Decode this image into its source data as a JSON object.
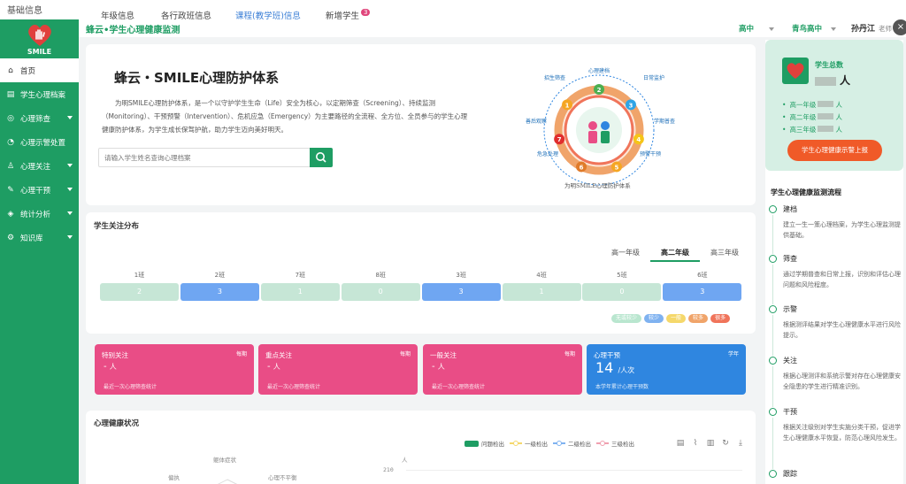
{
  "top": {
    "base_info": "基础信息",
    "tabs": [
      {
        "label": "年级信息"
      },
      {
        "label": "各行政班信息"
      },
      {
        "label": "课程(教学班)信息"
      },
      {
        "label": "新增学生",
        "badge": "3"
      }
    ]
  },
  "sidebar": {
    "logo_text": "SMILE",
    "items": [
      {
        "label": "首页",
        "icon": "home-icon"
      },
      {
        "label": "学生心理档案",
        "icon": "archive-icon"
      },
      {
        "label": "心理筛查",
        "icon": "location-icon"
      },
      {
        "label": "心理示警处置",
        "icon": "bell-icon"
      },
      {
        "label": "心理关注",
        "icon": "user-icon"
      },
      {
        "label": "心理干预",
        "icon": "tool-icon"
      },
      {
        "label": "统计分析",
        "icon": "shield-icon"
      },
      {
        "label": "知识库",
        "icon": "settings-icon"
      }
    ]
  },
  "header": {
    "title": "蜂云•学生心理健康监测",
    "school_stage": "高中",
    "school_name": "青鸟高中",
    "user_name": "孙丹江",
    "user_role": "老师"
  },
  "intro": {
    "heading": "蜂云・SMILE心理防护体系",
    "paragraph": "为明SMILE心理防护体系，是一个以守护学生生命（Life）安全为核心，以定期筛查（Screening）、持续监测（Monitoring）、干预预警（Intervention）、危机应急（Emergency）为主要路径的全流程、全方位、全员参与的学生心理健康防护体系，为学生成长保驾护航，助力学生迈向美好明天。",
    "search_placeholder": "请输入学生姓名查询心理档案",
    "diagram_caption": "为明SMILE心理防护体系",
    "diagram_labels": [
      {
        "num": "1",
        "label": "招生筛查",
        "color": "#f5a623"
      },
      {
        "num": "2",
        "label": "心理建档",
        "color": "#4caf50"
      },
      {
        "num": "3",
        "label": "日常监护",
        "color": "#2fa4e7"
      },
      {
        "num": "4",
        "label": "学期普查",
        "color": "#f5c518"
      },
      {
        "num": "5",
        "label": "预警干预",
        "color": "#f5a623"
      },
      {
        "num": "6",
        "label": "危急处理",
        "color": "#e07b2a"
      },
      {
        "num": "7",
        "label": "善后观察",
        "color": "#e02e2e"
      }
    ]
  },
  "distribution": {
    "title": "学生关注分布",
    "grade_tabs": [
      "高一年级",
      "高二年级",
      "高三年级"
    ],
    "active_grade": 1,
    "classes": [
      {
        "name": "1班",
        "value": "2",
        "level": "normal"
      },
      {
        "name": "2班",
        "value": "3",
        "level": "blue"
      },
      {
        "name": "7班",
        "value": "1",
        "level": "normal"
      },
      {
        "name": "8班",
        "value": "0",
        "level": "normal"
      },
      {
        "name": "3班",
        "value": "3",
        "level": "blue"
      },
      {
        "name": "4班",
        "value": "1",
        "level": "normal"
      },
      {
        "name": "5班",
        "value": "0",
        "level": "normal"
      },
      {
        "name": "6班",
        "value": "3",
        "level": "blue"
      }
    ],
    "legend": [
      {
        "label": "无或较少",
        "color": "#b9e6cf"
      },
      {
        "label": "较少",
        "color": "#7fb2f0"
      },
      {
        "label": "一般",
        "color": "#f5d86b"
      },
      {
        "label": "较多",
        "color": "#f0a46a"
      },
      {
        "label": "很多",
        "color": "#f0745a"
      }
    ]
  },
  "stats": [
    {
      "title": "特别关注",
      "right": "每期",
      "value": "-",
      "unit": "人",
      "note": "最近一次心理筛查统计",
      "color": "#e94d86"
    },
    {
      "title": "重点关注",
      "right": "每期",
      "value": "-",
      "unit": "人",
      "note": "最近一次心理筛查统计",
      "color": "#e94d86"
    },
    {
      "title": "一般关注",
      "right": "每期",
      "value": "-",
      "unit": "人",
      "note": "最近一次心理筛查统计",
      "color": "#e94d86"
    },
    {
      "title": "心理干预",
      "right": "学年",
      "value": "14",
      "unit": "/人次",
      "note": "本学年累计心理干预数",
      "color": "#2f86e0"
    }
  ],
  "health": {
    "title": "心理健康状况",
    "legend": [
      {
        "label": "问题检出",
        "type": "bar",
        "color": "#1e9d63"
      },
      {
        "label": "一级检出",
        "type": "line",
        "color": "#f5d86b"
      },
      {
        "label": "二级检出",
        "type": "line",
        "color": "#7fb2f0"
      },
      {
        "label": "三级检出",
        "type": "line",
        "color": "#f0a0b0"
      }
    ],
    "tools": [
      "doc-icon",
      "line-icon",
      "bar-icon",
      "refresh-icon",
      "download-icon"
    ],
    "radar_labels": [
      "躯体症状",
      "偏执",
      "心理不平衡"
    ],
    "y_unit": "人",
    "y_max": "210"
  },
  "right_panel": {
    "total_title": "学生总数",
    "total_unit": "人",
    "grades": [
      {
        "label": "高一年级",
        "unit": "人"
      },
      {
        "label": "高二年级",
        "unit": "人"
      },
      {
        "label": "高三年级",
        "unit": "人"
      }
    ],
    "button": "学生心理健康示警上报",
    "flow_title": "学生心理健康监测流程",
    "steps": [
      {
        "name": "建档",
        "desc": "建立一生一策心理档案，为学生心理监测提供基础。"
      },
      {
        "name": "筛查",
        "desc": "通过学期普查和日常上报，识别和评估心理问题和风险程度。"
      },
      {
        "name": "示警",
        "desc": "根据测评结果对学生心理健康水平进行风险提示。"
      },
      {
        "name": "关注",
        "desc": "根据心理测评和系统示警对存在心理健康安全隐患的学生进行精准识别。"
      },
      {
        "name": "干预",
        "desc": "根据关注级别对学生实施分类干预，促进学生心理健康水平恢复，防范心理风险发生。"
      },
      {
        "name": "跟踪",
        "desc": ""
      }
    ]
  }
}
